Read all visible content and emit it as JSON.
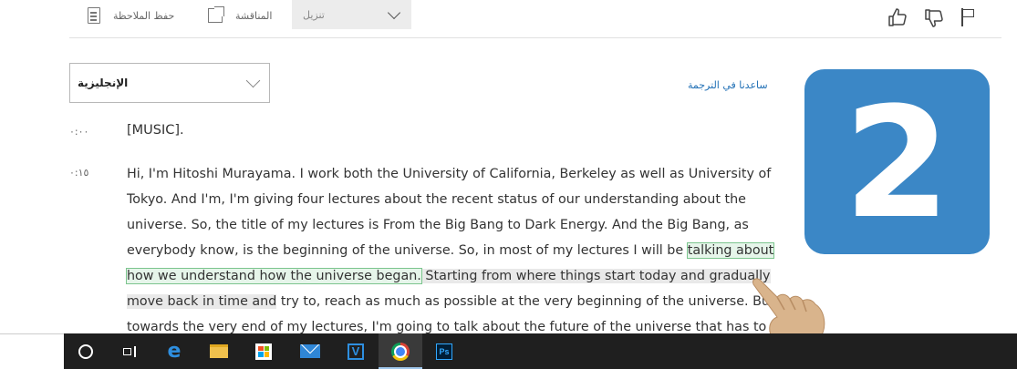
{
  "toolbar": {
    "save_note_label": "حفظ الملاحظة",
    "discussion_label": "المناقشة",
    "download_label": "تنزيل"
  },
  "language": {
    "selected": "الإنجليزية",
    "help_translate_link": "ساعدنا في الترجمة"
  },
  "transcript": {
    "entries": [
      {
        "timestamp": "٠:٠٠",
        "text": "[MUSIC]."
      },
      {
        "timestamp": "٠:١٥",
        "lines": {
          "l1": "Hi, I'm Hitoshi Murayama. I work both the University of California, Berkeley as well as University of",
          "l2": "Tokyo. And I'm, I'm giving four lectures about the recent status of our understanding about the",
          "l3": "universe. So, the title of my lectures is From the Big Bang to Dark Energy. And the Big Bang, as",
          "l4a": "everybody know, is the beginning of the universe. So, in most of my lectures I will be ",
          "l4b": "talking about",
          "l5a": "how we understand how the universe began.",
          "l5b": " Starting from where things start today and gradually",
          "l6a": "move back in time and",
          "l6b": " try to, reach as much as possible at the very beginning of the universe. But",
          "l7": "towards the very end of my lectures, I'm going to talk about the future of the universe that has to"
        }
      }
    ]
  },
  "badge": {
    "number": "2",
    "color": "#3b87c6"
  },
  "taskbar": {
    "icons": [
      "cortana-icon",
      "task-view-icon",
      "edge-icon",
      "file-explorer-icon",
      "store-icon",
      "mail-icon",
      "v-app-icon",
      "chrome-icon",
      "photoshop-icon"
    ],
    "active": "chrome-icon",
    "v_app_letter": "V",
    "photoshop_letters": "Ps"
  },
  "colors": {
    "link": "#1f6fb5",
    "highlight_green": "#e6f5ea",
    "highlight_gray": "#e9e9e9",
    "taskbar": "#1f1f1f"
  }
}
